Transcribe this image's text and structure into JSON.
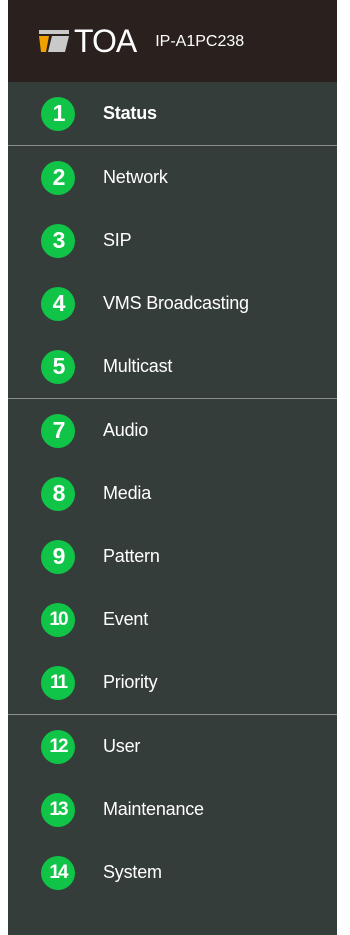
{
  "header": {
    "brand": "TOA",
    "model": "IP-A1PC238",
    "logo_icon": "toa-logo-icon"
  },
  "colors": {
    "sidebar_bg": "#353d3b",
    "header_bg": "#2a211e",
    "badge_green": "#0fc447",
    "divider": "#8a908e"
  },
  "menu": {
    "groups": [
      [
        {
          "num": "1",
          "label": "Status",
          "active": true
        }
      ],
      [
        {
          "num": "2",
          "label": "Network"
        },
        {
          "num": "3",
          "label": "SIP"
        },
        {
          "num": "4",
          "label": "VMS Broadcasting"
        },
        {
          "num": "5",
          "label": "Multicast"
        }
      ],
      [
        {
          "num": "7",
          "label": "Audio"
        },
        {
          "num": "8",
          "label": "Media"
        },
        {
          "num": "9",
          "label": "Pattern"
        },
        {
          "num": "10",
          "label": "Event"
        },
        {
          "num": "11",
          "label": "Priority"
        }
      ],
      [
        {
          "num": "12",
          "label": "User"
        },
        {
          "num": "13",
          "label": "Maintenance"
        },
        {
          "num": "14",
          "label": "System"
        }
      ]
    ]
  }
}
